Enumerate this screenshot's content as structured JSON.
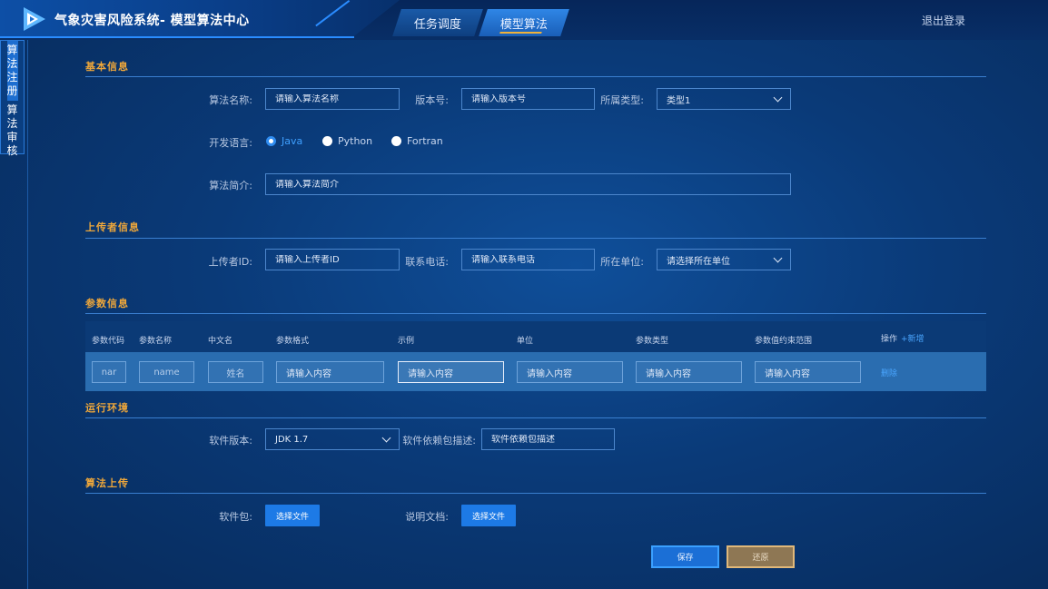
{
  "header": {
    "title": "气象灾害风险系统- 模型算法中心",
    "tabs": [
      {
        "label": "任务调度"
      },
      {
        "label": "模型算法"
      }
    ],
    "logout": "退出登录"
  },
  "sidebar": {
    "items": [
      {
        "label": "算法注册"
      },
      {
        "label": "算法审核"
      }
    ]
  },
  "basic": {
    "title": "基本信息",
    "name_label": "算法名称:",
    "name_placeholder": "请输入算法名称",
    "version_label": "版本号:",
    "version_placeholder": "请输入版本号",
    "type_label": "所属类型:",
    "type_value": "类型1",
    "lang_label": "开发语言:",
    "langs": [
      {
        "label": "Java",
        "selected": true
      },
      {
        "label": "Python",
        "selected": false
      },
      {
        "label": "Fortran",
        "selected": false
      }
    ],
    "intro_label": "算法简介:",
    "intro_placeholder": "请输入算法简介"
  },
  "uploader": {
    "title": "上传者信息",
    "id_label": "上传者ID:",
    "id_placeholder": "请输入上传者ID",
    "phone_label": "联系电话:",
    "phone_placeholder": "请输入联系电话",
    "org_label": "所在单位:",
    "org_value": "请选择所在单位"
  },
  "params": {
    "title": "参数信息",
    "columns": [
      "参数代码",
      "参数名称",
      "中文名",
      "参数格式",
      "示例",
      "单位",
      "参数类型",
      "参数值约束范围",
      "操作"
    ],
    "add_label": "+新增",
    "row": {
      "code": "nar",
      "name": "name",
      "cn_name": "姓名",
      "format": "请输入内容",
      "example": "请输入内容",
      "unit": "请输入内容",
      "type": "请输入内容",
      "range": "请输入内容",
      "delete": "删除"
    }
  },
  "runtime": {
    "title": "运行环境",
    "version_label": "软件版本:",
    "version_value": "JDK 1.7",
    "deps_label": "软件依赖包描述:",
    "deps_placeholder": "软件依赖包描述"
  },
  "upload": {
    "title": "算法上传",
    "package_label": "软件包:",
    "package_button": "选择文件",
    "doc_label": "说明文档:",
    "doc_button": "选择文件"
  },
  "actions": {
    "save": "保存",
    "restore": "还原"
  }
}
